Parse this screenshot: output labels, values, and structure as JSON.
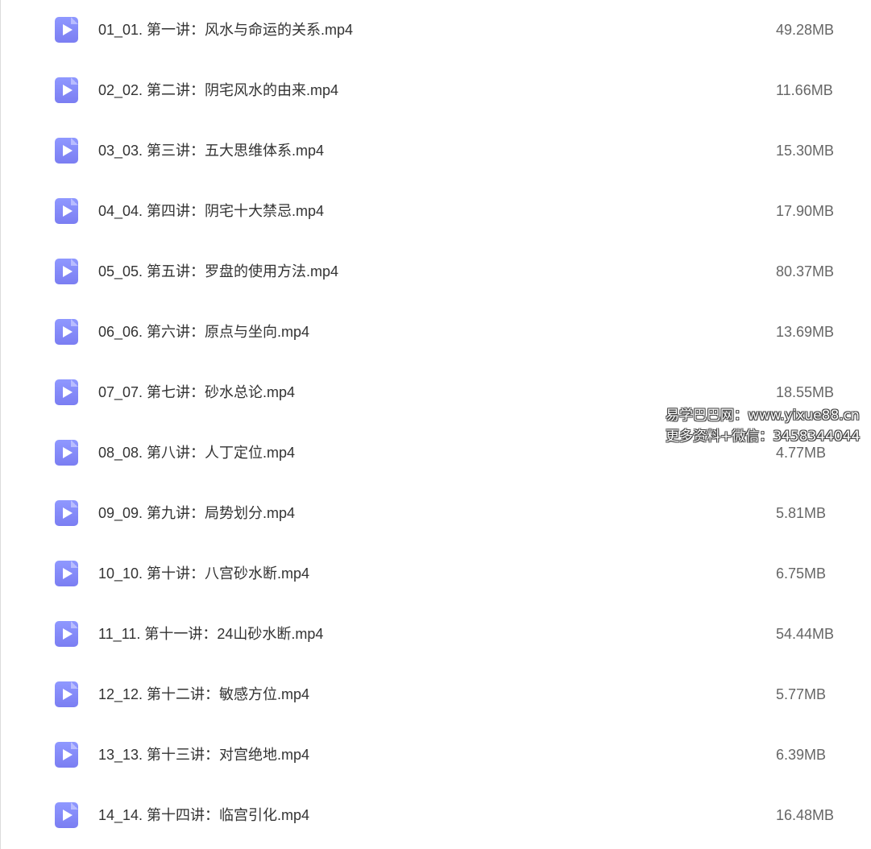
{
  "files": [
    {
      "name": "01_01. 第一讲：风水与命运的关系.mp4",
      "size": "49.28MB",
      "icon": "video-file-icon"
    },
    {
      "name": "02_02. 第二讲：阴宅风水的由来.mp4",
      "size": "11.66MB",
      "icon": "video-file-icon"
    },
    {
      "name": "03_03. 第三讲：五大思维体系.mp4",
      "size": "15.30MB",
      "icon": "video-file-icon"
    },
    {
      "name": "04_04. 第四讲：阴宅十大禁忌.mp4",
      "size": "17.90MB",
      "icon": "video-file-icon"
    },
    {
      "name": "05_05. 第五讲：罗盘的使用方法.mp4",
      "size": "80.37MB",
      "icon": "video-file-icon"
    },
    {
      "name": "06_06. 第六讲：原点与坐向.mp4",
      "size": "13.69MB",
      "icon": "video-file-icon"
    },
    {
      "name": "07_07. 第七讲：砂水总论.mp4",
      "size": "18.55MB",
      "icon": "video-file-icon"
    },
    {
      "name": "08_08. 第八讲：人丁定位.mp4",
      "size": "4.77MB",
      "icon": "video-file-icon"
    },
    {
      "name": "09_09. 第九讲：局势划分.mp4",
      "size": "5.81MB",
      "icon": "video-file-icon"
    },
    {
      "name": "10_10. 第十讲：八宫砂水断.mp4",
      "size": "6.75MB",
      "icon": "video-file-icon"
    },
    {
      "name": "11_11. 第十一讲：24山砂水断.mp4",
      "size": "54.44MB",
      "icon": "video-file-icon"
    },
    {
      "name": "12_12. 第十二讲：敏感方位.mp4",
      "size": "5.77MB",
      "icon": "video-file-icon"
    },
    {
      "name": "13_13. 第十三讲：对宫绝地.mp4",
      "size": "6.39MB",
      "icon": "video-file-icon"
    },
    {
      "name": "14_14. 第十四讲：临宫引化.mp4",
      "size": "16.48MB",
      "icon": "video-file-icon"
    }
  ],
  "watermark": {
    "line1": "易学巴巴网：www.yixue88.cn",
    "line2": "更多资料+微信：3458344044"
  },
  "colors": {
    "icon_top": "#8f98ff",
    "icon_bottom": "#7b7ef2",
    "name_text": "#333333",
    "size_text": "#666666"
  }
}
